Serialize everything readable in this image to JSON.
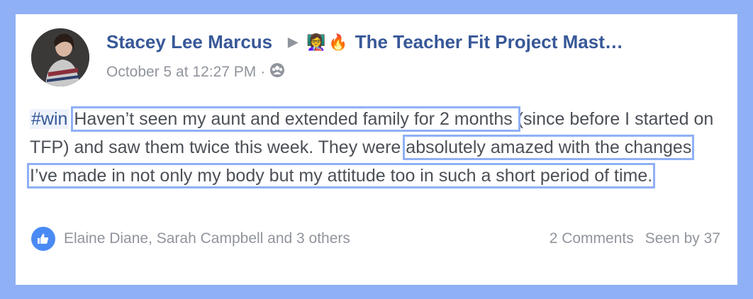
{
  "post": {
    "author": "Stacey Lee Marcus",
    "group_emoji_1": "👩‍🏫",
    "group_emoji_2": "🔥",
    "group_name": "The Teacher Fit Project Mast…",
    "timestamp": "October 5 at 12:27 PM",
    "meta_separator": "·",
    "audience_icon": "group-icon",
    "hashtag": "#win",
    "text_segments": [
      " ",
      "Haven’t seen my aunt and extended family for 2 months ",
      "(since before I started on TFP) and saw them twice this week. They were ",
      "absolutely amazed with the changes I’ve made in not only my body but my attitude too in such a short period of time."
    ]
  },
  "footer": {
    "reactions_icon": "like-icon",
    "reactions_text": "Elaine Diane, Sarah Campbell and 3 others",
    "comments": "2 Comments",
    "seen_by": "Seen by 37"
  },
  "colors": {
    "frame": "#8fb0f5",
    "author": "#385898",
    "muted": "#90949c",
    "body_text": "#4b4f56",
    "like_blue": "#4a8af4"
  }
}
